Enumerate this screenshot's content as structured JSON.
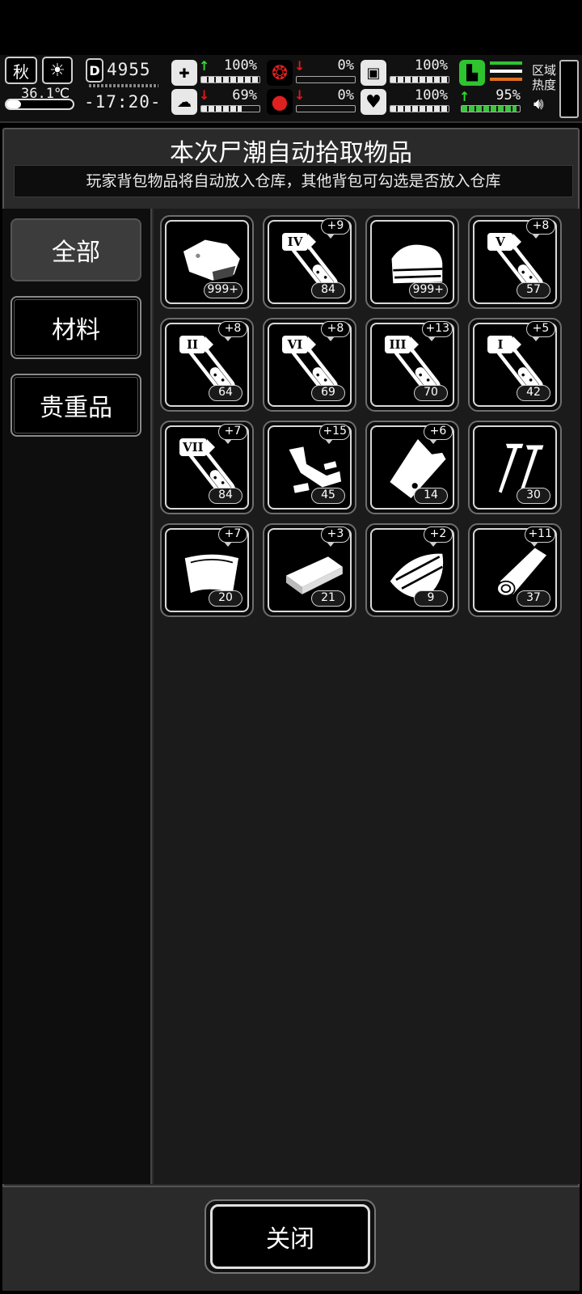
{
  "hud": {
    "season": "秋",
    "temperature": "36.1℃",
    "day_count": "4955",
    "clock": "-17:20-",
    "region_heat_label_1": "区域",
    "region_heat_label_2": "热度",
    "stats": [
      {
        "name": "health",
        "value": "100%",
        "trend": "up",
        "fill": 1.0
      },
      {
        "name": "stomach",
        "value": "0%",
        "trend": "down",
        "fill": 0.0
      },
      {
        "name": "thirst",
        "value": "100%",
        "trend": "none",
        "fill": 1.0
      },
      {
        "name": "mood",
        "value": "69%",
        "trend": "down",
        "fill": 0.69
      },
      {
        "name": "blood",
        "value": "0%",
        "trend": "down",
        "fill": 0.0
      },
      {
        "name": "heart",
        "value": "100%",
        "trend": "none",
        "fill": 1.0
      },
      {
        "name": "stamina",
        "value": "95%",
        "trend": "up",
        "fill": 0.95
      }
    ]
  },
  "panel": {
    "title": "本次尸潮自动拾取物品",
    "subtitle": "玩家背包物品将自动放入仓库，其他背包可勾选是否放入仓库"
  },
  "tabs": [
    {
      "label": "全部",
      "active": true
    },
    {
      "label": "材料",
      "active": false
    },
    {
      "label": "贵重品",
      "active": false
    }
  ],
  "items": [
    {
      "icon": "meat-icon",
      "count": "999+",
      "plus": ""
    },
    {
      "icon": "serum-vial-icon",
      "tier": "IV",
      "count": "84",
      "plus": "+9"
    },
    {
      "icon": "cloth-icon",
      "count": "999+",
      "plus": ""
    },
    {
      "icon": "serum-vial-icon",
      "tier": "V",
      "count": "57",
      "plus": "+8"
    },
    {
      "icon": "serum-vial-icon",
      "tier": "II",
      "count": "64",
      "plus": "+8"
    },
    {
      "icon": "serum-vial-icon",
      "tier": "VI",
      "count": "69",
      "plus": "+8"
    },
    {
      "icon": "serum-vial-icon",
      "tier": "III",
      "count": "70",
      "plus": "+13"
    },
    {
      "icon": "serum-vial-icon",
      "tier": "I",
      "count": "42",
      "plus": "+5"
    },
    {
      "icon": "serum-vial-icon",
      "tier": "VII",
      "count": "84",
      "plus": "+7"
    },
    {
      "icon": "scrap-metal-icon",
      "count": "45",
      "plus": "+15"
    },
    {
      "icon": "plastic-bag-icon",
      "count": "14",
      "plus": "+6"
    },
    {
      "icon": "screws-icon",
      "count": "30",
      "plus": ""
    },
    {
      "icon": "leather-icon",
      "count": "20",
      "plus": "+7"
    },
    {
      "icon": "wood-plank-icon",
      "count": "21",
      "plus": "+3"
    },
    {
      "icon": "wood-log-icon",
      "count": "9",
      "plus": "+2"
    },
    {
      "icon": "timber-icon",
      "count": "37",
      "plus": "+11"
    }
  ],
  "footer": {
    "close_label": "关闭"
  }
}
